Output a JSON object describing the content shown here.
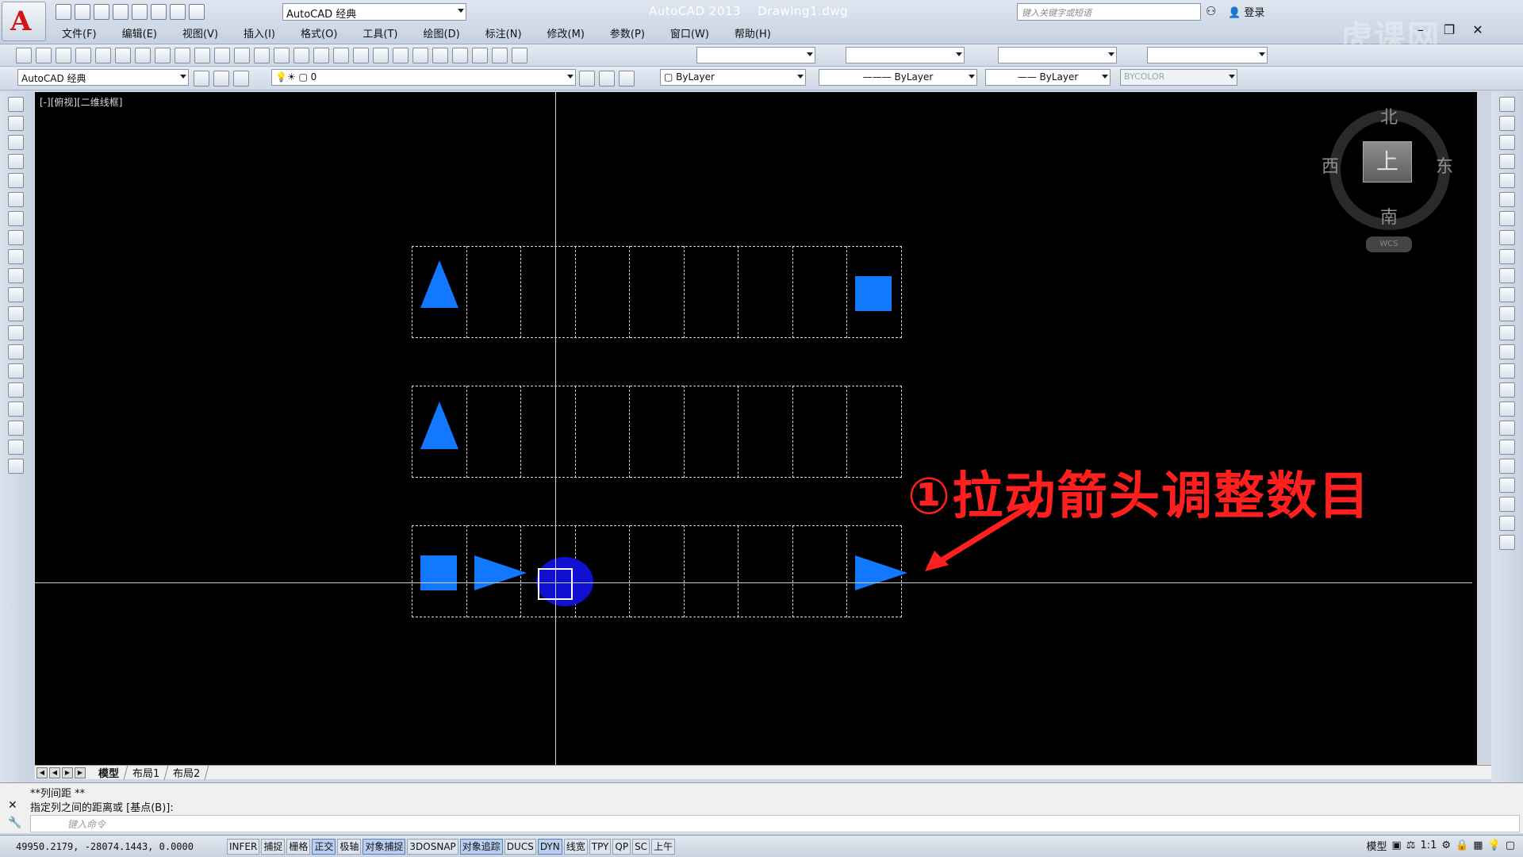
{
  "app": {
    "title": "AutoCAD 2013",
    "document": "Drawing1.dwg",
    "app_letter": "A",
    "workspace": "AutoCAD 经典",
    "search_placeholder": "键入关键字或短语",
    "login": "登录",
    "watermark": "虎课网"
  },
  "menu": [
    "文件(F)",
    "编辑(E)",
    "视图(V)",
    "插入(I)",
    "格式(O)",
    "工具(T)",
    "绘图(D)",
    "标注(N)",
    "修改(M)",
    "参数(P)",
    "窗口(W)",
    "帮助(H)"
  ],
  "properties": {
    "workspace2": "AutoCAD 经典",
    "layer": "0",
    "color": "ByLayer",
    "linetype": "ByLayer",
    "lineweight": "ByLayer",
    "plotstyle": "BYCOLOR"
  },
  "viewport": {
    "label": "[-][俯视][二维线框]"
  },
  "viewcube": {
    "north": "北",
    "south": "南",
    "east": "东",
    "west": "西",
    "top": "上",
    "wcs": "WCS"
  },
  "annotation": "①拉动箭头调整数目",
  "tabs": [
    "模型",
    "布局1",
    "布局2"
  ],
  "command": {
    "line1": "**列间距 **",
    "line2": "指定列之间的距离或 [基点(B)]:",
    "input_placeholder": "键入命令"
  },
  "status": {
    "coords": "49950.2179, -28074.1443, 0.0000",
    "toggles": [
      {
        "label": "INFER",
        "on": false
      },
      {
        "label": "捕捉",
        "on": false
      },
      {
        "label": "栅格",
        "on": false
      },
      {
        "label": "正交",
        "on": true
      },
      {
        "label": "极轴",
        "on": false
      },
      {
        "label": "对象捕捉",
        "on": true
      },
      {
        "label": "3DOSNAP",
        "on": false
      },
      {
        "label": "对象追踪",
        "on": true
      },
      {
        "label": "DUCS",
        "on": false
      },
      {
        "label": "DYN",
        "on": true
      },
      {
        "label": "线宽",
        "on": false
      },
      {
        "label": "TPY",
        "on": false
      },
      {
        "label": "QP",
        "on": false
      },
      {
        "label": "SC",
        "on": false
      },
      {
        "label": "上午",
        "on": false
      }
    ],
    "model": "模型",
    "scale": "1:1"
  },
  "colors": {
    "shape": "#1278ff",
    "annotation": "#ff1f1f",
    "canvas": "#000000"
  }
}
